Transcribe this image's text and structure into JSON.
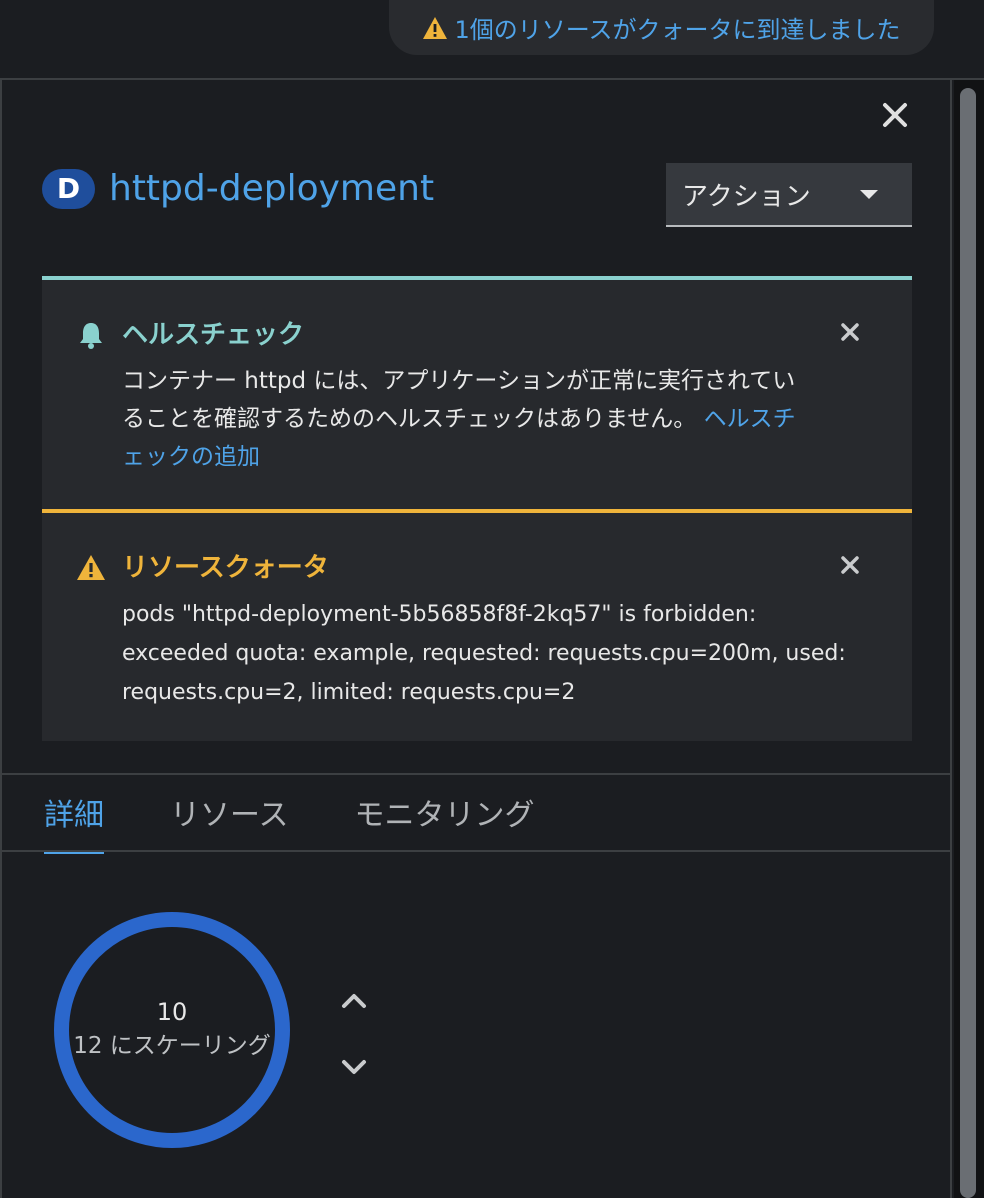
{
  "notification": {
    "text": "1個のリソースがクォータに到達しました"
  },
  "drawer": {
    "badge": "D",
    "title": "httpd-deployment",
    "actions_label": "アクション"
  },
  "alerts": [
    {
      "type": "health",
      "title": "ヘルスチェック",
      "body_line1": "コンテナー httpd には、アプリケーションが正常に実行されてい",
      "body_line2": "ることを確認するためのヘルスチェックはありません。",
      "link_part1": "ヘルスチ",
      "link_part2": "ェックの追加"
    },
    {
      "type": "quota",
      "title": "リソースクォータ",
      "body_line1": "pods \"httpd-deployment-5b56858f8f-2kq57\" is forbidden:",
      "body_line2": "exceeded quota: example, requested: requests.cpu=200m, used:",
      "body_line3": "requests.cpu=2, limited: requests.cpu=2"
    }
  ],
  "tabs": [
    "詳細",
    "リソース",
    "モニタリング"
  ],
  "active_tab": "詳細",
  "pods": {
    "count": "10",
    "scaling_label": "12 にスケーリング"
  },
  "colors": {
    "accent": "#4fa3e8",
    "health": "#8ad1ce",
    "warning": "#efb43b",
    "ring": "#2b67cc"
  }
}
